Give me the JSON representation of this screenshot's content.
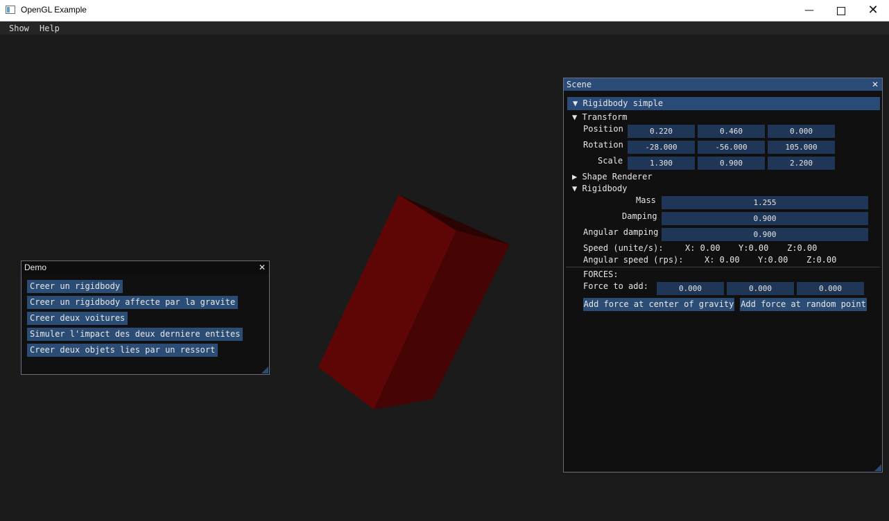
{
  "window": {
    "title": "OpenGL Example",
    "controls": {
      "minimize": "—",
      "close": "✕"
    }
  },
  "menu": {
    "show": "Show",
    "help": "Help"
  },
  "demo": {
    "title": "Demo",
    "close": "✕",
    "buttons": [
      "Creer un rigidbody",
      "Creer un rigidbody affecte par la gravite",
      "Creer deux voitures",
      "Simuler l'impact des deux derniere entites",
      "Creer deux objets lies par un ressort"
    ]
  },
  "scene": {
    "title": "Scene",
    "close": "✕",
    "object_header": "▼ Rigidbody simple",
    "transform": {
      "header": "▼ Transform",
      "position": {
        "label": "Position",
        "values": [
          "0.220",
          "0.460",
          "0.000"
        ]
      },
      "rotation": {
        "label": "Rotation",
        "values": [
          "-28.000",
          "-56.000",
          "105.000"
        ]
      },
      "scale": {
        "label": "Scale",
        "values": [
          "1.300",
          "0.900",
          "2.200"
        ]
      }
    },
    "shape_renderer": "▶ Shape Renderer",
    "rigidbody": {
      "header": "▼ Rigidbody",
      "mass": {
        "label": "Mass",
        "value": "1.255"
      },
      "damping": {
        "label": "Damping",
        "value": "0.900"
      },
      "angular_damping": {
        "label": "Angular damping",
        "value": "0.900"
      },
      "speed": {
        "label": "Speed (unite/s):",
        "x": "X: 0.00",
        "y": "Y:0.00",
        "z": "Z:0.00"
      },
      "angular_speed": {
        "label": "Angular speed (rps):",
        "x": "X: 0.00",
        "y": "Y:0.00",
        "z": "Z:0.00"
      }
    },
    "forces": {
      "header": "FORCES:",
      "label": "Force to add:",
      "values": [
        "0.000",
        "0.000",
        "0.000"
      ],
      "btn_center": "Add force at center of gravity",
      "btn_random": "Add force at random point"
    }
  },
  "colors": {
    "cube_front": "#5e0606",
    "cube_side": "#460404",
    "cube_top": "#280303",
    "accent": "#2a4c75"
  }
}
